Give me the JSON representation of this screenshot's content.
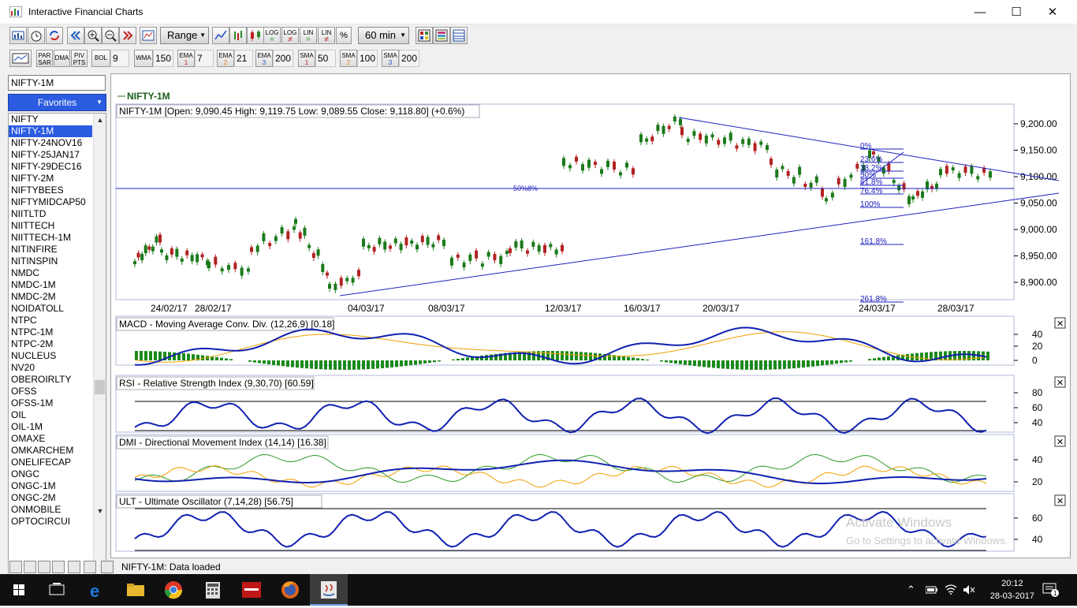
{
  "window": {
    "title": "Interactive Financial Charts",
    "minimize": "—",
    "maximize": "☐",
    "close": "✕"
  },
  "toolbar": {
    "range_label": "Range",
    "interval_label": "60 min",
    "log_label": "LOG",
    "lin_label": "LIN",
    "pct_label": "%",
    "scale_eq": "=",
    "scale_ne": "≠"
  },
  "indicators": {
    "par_sar": "PAR SAR",
    "dma": "DMA",
    "piv_pts": "PIV PTS",
    "bol_label": "BOL",
    "bol_value": "9",
    "wma_label": "WMA",
    "wma_value": "150",
    "ema1_label": "EMA",
    "ema1_sub": "1",
    "ema1_value": "7",
    "ema2_label": "EMA",
    "ema2_sub": "2",
    "ema2_value": "21",
    "ema3_label": "EMA",
    "ema3_sub": "3",
    "ema3_value": "200",
    "sma1_label": "SMA",
    "sma1_sub": "1",
    "sma1_value": "50",
    "sma2_label": "SMA",
    "sma2_sub": "2",
    "sma2_value": "100",
    "sma3_label": "SMA",
    "sma3_sub": "3",
    "sma3_value": "200"
  },
  "sidebar": {
    "symbol_value": "NIFTY-1M",
    "favorites_label": "Favorites",
    "selected_index": 1,
    "items": [
      "NIFTY",
      "NIFTY-1M",
      "NIFTY-24NOV16",
      "NIFTY-25JAN17",
      "NIFTY-29DEC16",
      "NIFTY-2M",
      "NIFTYBEES",
      "NIFTYMIDCAP50",
      "NIITLTD",
      "NIITTECH",
      "NIITTECH-1M",
      "NITINFIRE",
      "NITINSPIN",
      "NMDC",
      "NMDC-1M",
      "NMDC-2M",
      "NOIDATOLL",
      "NTPC",
      "NTPC-1M",
      "NTPC-2M",
      "NUCLEUS",
      "NV20",
      "OBEROIRLTY",
      "OFSS",
      "OFSS-1M",
      "OIL",
      "OIL-1M",
      "OMAXE",
      "OMKARCHEM",
      "ONELIFECAP",
      "ONGC",
      "ONGC-1M",
      "ONGC-2M",
      "ONMOBILE",
      "OPTOCIRCUI"
    ]
  },
  "chart": {
    "legend": "NIFTY-1M",
    "price_header": "NIFTY-1M [Open: 9,090.45  High: 9,119.75  Low: 9,089.55  Close: 9,118.80] (+0.6%)",
    "price_axis": [
      "9,200.00",
      "9,150.00",
      "9,100.00",
      "9,050.00",
      "9,000.00",
      "8,950.00",
      "8,900.00"
    ],
    "date_axis": [
      "24/02/17",
      "28/02/17",
      "04/03/17",
      "08/03/17",
      "12/03/17",
      "16/03/17",
      "20/03/17",
      "24/03/17",
      "28/03/17"
    ],
    "fib_labels": [
      "0%",
      "23.6%",
      "38.2%",
      "50%",
      "61.8%",
      "76.4%",
      "100%",
      "161.8%",
      "261.8%"
    ],
    "fib_overlap_text": "50%8%",
    "macd_header": "MACD - Moving Average Conv. Div. (12,26,9) [0.18]",
    "macd_axis": [
      "40",
      "20",
      "0"
    ],
    "rsi_header": "RSI - Relative Strength Index (9,30,70) [60.59]",
    "rsi_axis": [
      "80",
      "60",
      "40"
    ],
    "dmi_header": "DMI - Directional Movement Index (14,14) [16.38]",
    "dmi_axis": [
      "40",
      "20"
    ],
    "ult_header": "ULT - Ultimate Oscillator (7,14,28) [56.75]",
    "ult_axis": [
      "60",
      "40"
    ],
    "panel_close": "✕",
    "watermark_line1": "Activate Windows",
    "watermark_line2": "Go to Settings to activate Windows."
  },
  "status": {
    "message": "NIFTY-1M: Data loaded"
  },
  "taskbar": {
    "time": "20:12",
    "date": "28-03-2017",
    "notifications": "1"
  },
  "colors": {
    "up": "#1a7a1a",
    "down": "#b22222",
    "trend": "#2020c0",
    "selection": "#2b5be0",
    "signal": "#f0a000"
  }
}
